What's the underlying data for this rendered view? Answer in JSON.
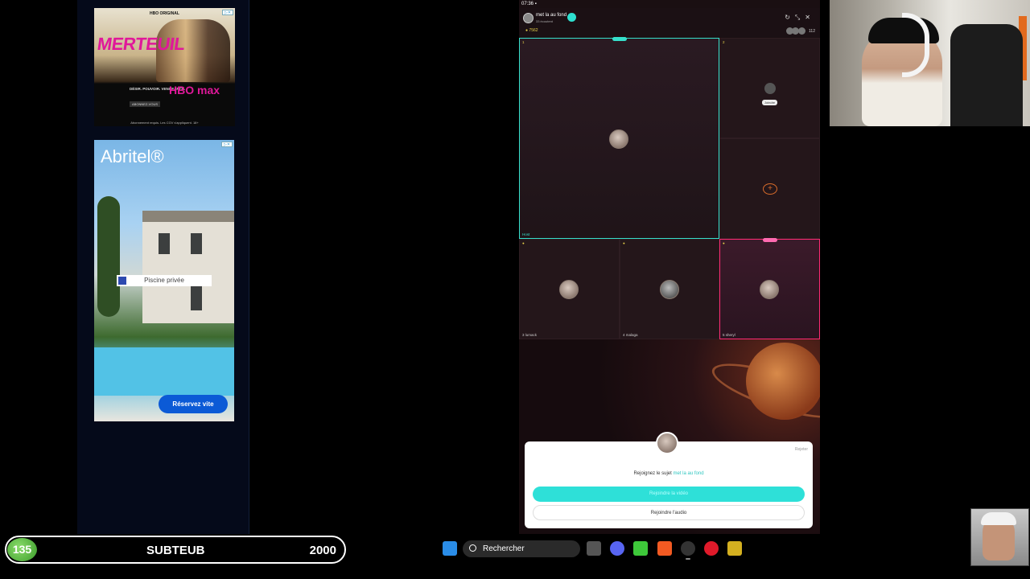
{
  "system": {
    "clock": "07:36"
  },
  "ads": {
    "hbo": {
      "top": "HBO ORIGINAL",
      "title": "MERTEUIL",
      "tagline": "DÉSIR. POUVOIR. VENGEANCE.",
      "subscribe": "ABONNEZ-VOUS",
      "brand": "HBO max",
      "price": "DÈS 3,99 €/MOIS",
      "fineprint": "Abonnement requis. Les CGV s'appliquent. 18+"
    },
    "abritel": {
      "brand": "Abritel®",
      "feature": "Piscine privée",
      "cta": "Réservez vite"
    }
  },
  "room": {
    "title": "met la au fond",
    "subtitle": "33 écoutent",
    "coins": "7562",
    "viewer_count": "112"
  },
  "tiles": [
    {
      "rank": "1",
      "name": "Host"
    },
    {
      "rank": "2",
      "join": "Joindre"
    },
    {
      "rank": ""
    },
    {
      "rank": "3",
      "name": "3 lumack"
    },
    {
      "rank": "4",
      "name": "4 malaga"
    },
    {
      "rank": "5",
      "name": "5 sheryl"
    }
  ],
  "modal": {
    "ignore": "Rejeter",
    "prompt": "Rejoignez le sujet",
    "topic": "met la au fond",
    "video_button": "Rejoindre la vidéo",
    "audio_button": "Rejoindre l'audio"
  },
  "subgoal": {
    "current": "135",
    "label": "SUBTEUB",
    "goal": "2000"
  },
  "taskbar": {
    "search_placeholder": "Rechercher"
  },
  "colors": {
    "host_border": "#36e0cc",
    "active_border": "#ff2a74",
    "accent": "#2ee0d8"
  }
}
